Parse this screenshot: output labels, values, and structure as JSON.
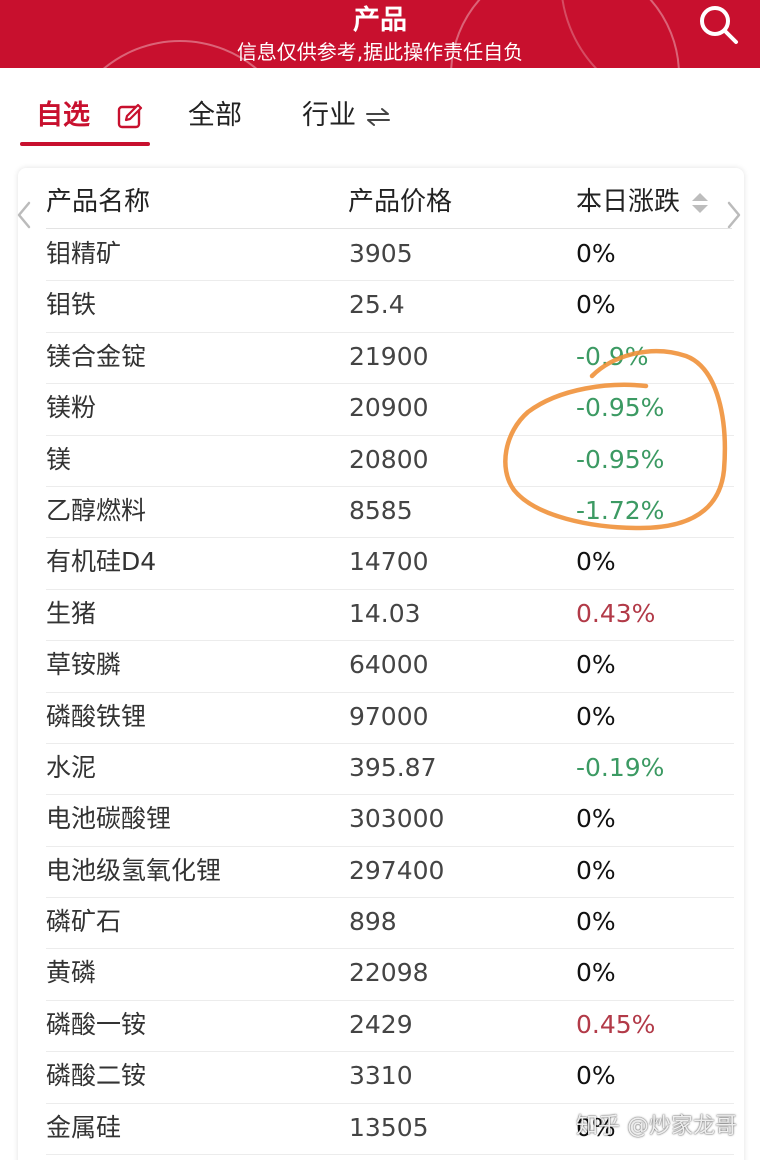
{
  "header": {
    "title": "产品",
    "subtitle": "信息仅供参考,据此操作责任自负",
    "search_icon": "search-icon",
    "background_color": "#c8102e"
  },
  "tabs": [
    {
      "label": "自选",
      "active": true,
      "icon": "edit-icon"
    },
    {
      "label": "全部",
      "active": false
    },
    {
      "label": "行业",
      "active": false,
      "icon": "swap-arrows-icon"
    }
  ],
  "table": {
    "columns": [
      "产品名称",
      "产品价格",
      "本日涨跌"
    ],
    "sort_icon": "sort-up-down-icon",
    "colors": {
      "up": "#b23a48",
      "down": "#3c9a63",
      "flat": "#111111"
    },
    "rows": [
      {
        "name": "钼精矿",
        "price": "3905",
        "change": "0%",
        "trend": "flat"
      },
      {
        "name": "钼铁",
        "price": "25.4",
        "change": "0%",
        "trend": "flat"
      },
      {
        "name": "镁合金锭",
        "price": "21900",
        "change": "-0.9%",
        "trend": "down"
      },
      {
        "name": "镁粉",
        "price": "20900",
        "change": "-0.95%",
        "trend": "down"
      },
      {
        "name": "镁",
        "price": "20800",
        "change": "-0.95%",
        "trend": "down"
      },
      {
        "name": "乙醇燃料",
        "price": "8585",
        "change": "-1.72%",
        "trend": "down"
      },
      {
        "name": "有机硅D4",
        "price": "14700",
        "change": "0%",
        "trend": "flat"
      },
      {
        "name": "生猪",
        "price": "14.03",
        "change": "0.43%",
        "trend": "up"
      },
      {
        "name": "草铵膦",
        "price": "64000",
        "change": "0%",
        "trend": "flat"
      },
      {
        "name": "磷酸铁锂",
        "price": "97000",
        "change": "0%",
        "trend": "flat"
      },
      {
        "name": "水泥",
        "price": "395.87",
        "change": "-0.19%",
        "trend": "down"
      },
      {
        "name": "电池碳酸锂",
        "price": "303000",
        "change": "0%",
        "trend": "flat"
      },
      {
        "name": "电池级氢氧化锂",
        "price": "297400",
        "change": "0%",
        "trend": "flat"
      },
      {
        "name": "磷矿石",
        "price": "898",
        "change": "0%",
        "trend": "flat"
      },
      {
        "name": "黄磷",
        "price": "22098",
        "change": "0%",
        "trend": "flat"
      },
      {
        "name": "磷酸一铵",
        "price": "2429",
        "change": "0.45%",
        "trend": "up"
      },
      {
        "name": "磷酸二铵",
        "price": "3310",
        "change": "0%",
        "trend": "flat"
      },
      {
        "name": "金属硅",
        "price": "13505",
        "change": "0%",
        "trend": "flat"
      }
    ]
  },
  "annotation": {
    "color": "#f0913a"
  },
  "watermark": "知乎 @炒家龙哥"
}
